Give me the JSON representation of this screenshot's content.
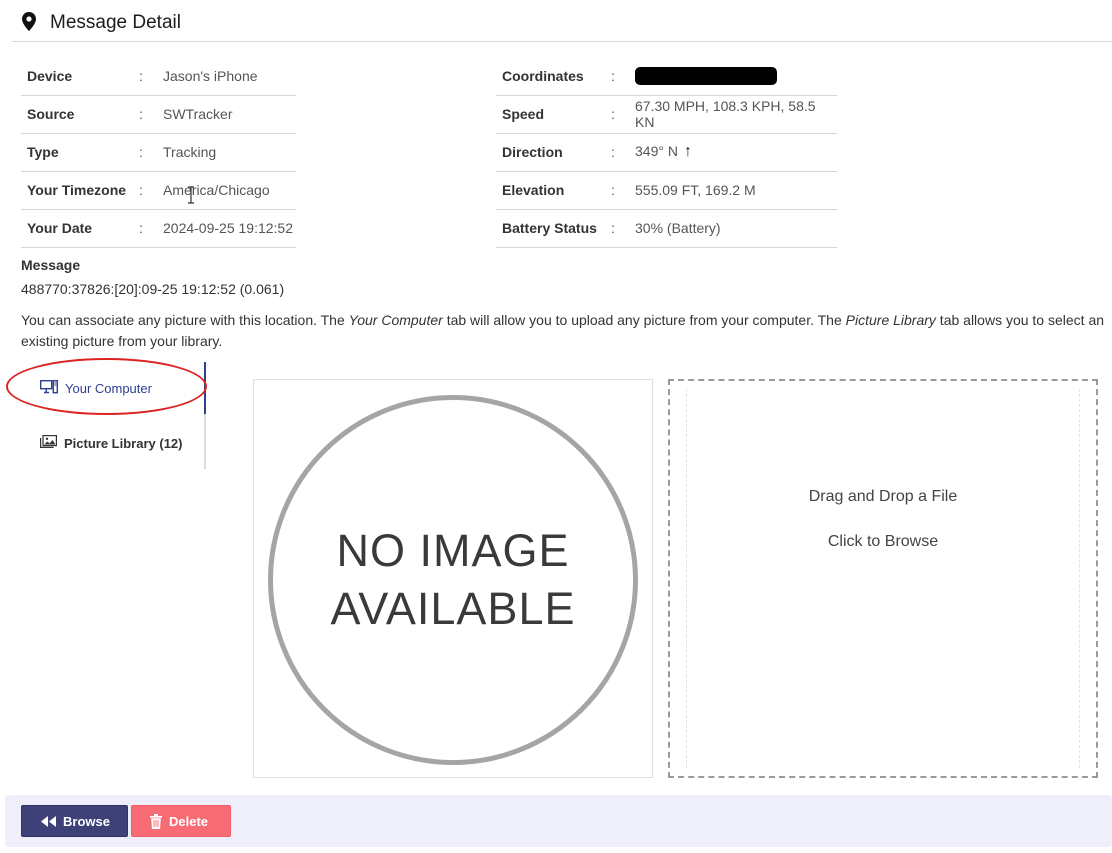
{
  "header": {
    "title": "Message Detail",
    "icon": "map-pin-icon"
  },
  "details_left": [
    {
      "key": "Device",
      "sep": ":",
      "value": "Jason's iPhone"
    },
    {
      "key": "Source",
      "sep": ":",
      "value": "SWTracker"
    },
    {
      "key": "Type",
      "sep": ":",
      "value": "Tracking"
    },
    {
      "key": "Your Timezone",
      "sep": ":",
      "value": "America/Chicago"
    },
    {
      "key": "Your Date",
      "sep": ":",
      "value": "2024-09-25 19:12:52"
    }
  ],
  "details_right": [
    {
      "key": "Coordinates",
      "sep": ":",
      "value": ""
    },
    {
      "key": "Speed",
      "sep": ":",
      "value": "67.30 MPH, 108.3 KPH, 58.5 KN"
    },
    {
      "key": "Direction",
      "sep": ":",
      "value": "349° N",
      "arrow": "↑"
    },
    {
      "key": "Elevation",
      "sep": ":",
      "value": "555.09 FT, 169.2 M"
    },
    {
      "key": "Battery Status",
      "sep": ":",
      "value": "30% (Battery)"
    }
  ],
  "message": {
    "label": "Message",
    "value": "488770:37826:[20]:09-25 19:12:52 (0.061)"
  },
  "description": {
    "part1": "You can associate any picture with this location. The ",
    "em1": "Your Computer",
    "part2": " tab will allow you to upload any picture from your computer. The ",
    "em2": "Picture Library",
    "part3": " tab allows you to select an existing picture from your library."
  },
  "tabs": [
    {
      "label": "Your Computer",
      "icon": "computer-icon",
      "active": true
    },
    {
      "label": "Picture Library (12)",
      "icon": "image-icon",
      "active": false
    }
  ],
  "preview": {
    "line1": "NO IMAGE",
    "line2": "AVAILABLE"
  },
  "dropzone": {
    "line1": "Drag and Drop a File",
    "line2": "Click to Browse"
  },
  "footer": {
    "browse_label": "Browse",
    "browse_icon": "backward-icon",
    "browse_color": "#3d4178",
    "delete_label": "Delete",
    "delete_icon": "trash-icon",
    "delete_color": "#f76b75"
  },
  "colors": {
    "accent": "#2d3f91",
    "annotation": "#dd2222",
    "footer_bg": "#eeeffa"
  }
}
